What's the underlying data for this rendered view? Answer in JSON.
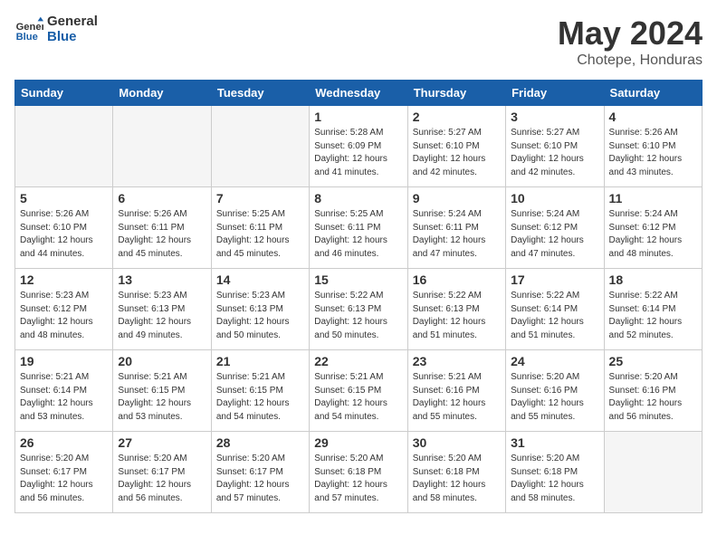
{
  "header": {
    "logo_line1": "General",
    "logo_line2": "Blue",
    "month": "May 2024",
    "location": "Chotepe, Honduras"
  },
  "weekdays": [
    "Sunday",
    "Monday",
    "Tuesday",
    "Wednesday",
    "Thursday",
    "Friday",
    "Saturday"
  ],
  "weeks": [
    [
      {
        "day": "",
        "info": ""
      },
      {
        "day": "",
        "info": ""
      },
      {
        "day": "",
        "info": ""
      },
      {
        "day": "1",
        "info": "Sunrise: 5:28 AM\nSunset: 6:09 PM\nDaylight: 12 hours\nand 41 minutes."
      },
      {
        "day": "2",
        "info": "Sunrise: 5:27 AM\nSunset: 6:10 PM\nDaylight: 12 hours\nand 42 minutes."
      },
      {
        "day": "3",
        "info": "Sunrise: 5:27 AM\nSunset: 6:10 PM\nDaylight: 12 hours\nand 42 minutes."
      },
      {
        "day": "4",
        "info": "Sunrise: 5:26 AM\nSunset: 6:10 PM\nDaylight: 12 hours\nand 43 minutes."
      }
    ],
    [
      {
        "day": "5",
        "info": "Sunrise: 5:26 AM\nSunset: 6:10 PM\nDaylight: 12 hours\nand 44 minutes."
      },
      {
        "day": "6",
        "info": "Sunrise: 5:26 AM\nSunset: 6:11 PM\nDaylight: 12 hours\nand 45 minutes."
      },
      {
        "day": "7",
        "info": "Sunrise: 5:25 AM\nSunset: 6:11 PM\nDaylight: 12 hours\nand 45 minutes."
      },
      {
        "day": "8",
        "info": "Sunrise: 5:25 AM\nSunset: 6:11 PM\nDaylight: 12 hours\nand 46 minutes."
      },
      {
        "day": "9",
        "info": "Sunrise: 5:24 AM\nSunset: 6:11 PM\nDaylight: 12 hours\nand 47 minutes."
      },
      {
        "day": "10",
        "info": "Sunrise: 5:24 AM\nSunset: 6:12 PM\nDaylight: 12 hours\nand 47 minutes."
      },
      {
        "day": "11",
        "info": "Sunrise: 5:24 AM\nSunset: 6:12 PM\nDaylight: 12 hours\nand 48 minutes."
      }
    ],
    [
      {
        "day": "12",
        "info": "Sunrise: 5:23 AM\nSunset: 6:12 PM\nDaylight: 12 hours\nand 48 minutes."
      },
      {
        "day": "13",
        "info": "Sunrise: 5:23 AM\nSunset: 6:13 PM\nDaylight: 12 hours\nand 49 minutes."
      },
      {
        "day": "14",
        "info": "Sunrise: 5:23 AM\nSunset: 6:13 PM\nDaylight: 12 hours\nand 50 minutes."
      },
      {
        "day": "15",
        "info": "Sunrise: 5:22 AM\nSunset: 6:13 PM\nDaylight: 12 hours\nand 50 minutes."
      },
      {
        "day": "16",
        "info": "Sunrise: 5:22 AM\nSunset: 6:13 PM\nDaylight: 12 hours\nand 51 minutes."
      },
      {
        "day": "17",
        "info": "Sunrise: 5:22 AM\nSunset: 6:14 PM\nDaylight: 12 hours\nand 51 minutes."
      },
      {
        "day": "18",
        "info": "Sunrise: 5:22 AM\nSunset: 6:14 PM\nDaylight: 12 hours\nand 52 minutes."
      }
    ],
    [
      {
        "day": "19",
        "info": "Sunrise: 5:21 AM\nSunset: 6:14 PM\nDaylight: 12 hours\nand 53 minutes."
      },
      {
        "day": "20",
        "info": "Sunrise: 5:21 AM\nSunset: 6:15 PM\nDaylight: 12 hours\nand 53 minutes."
      },
      {
        "day": "21",
        "info": "Sunrise: 5:21 AM\nSunset: 6:15 PM\nDaylight: 12 hours\nand 54 minutes."
      },
      {
        "day": "22",
        "info": "Sunrise: 5:21 AM\nSunset: 6:15 PM\nDaylight: 12 hours\nand 54 minutes."
      },
      {
        "day": "23",
        "info": "Sunrise: 5:21 AM\nSunset: 6:16 PM\nDaylight: 12 hours\nand 55 minutes."
      },
      {
        "day": "24",
        "info": "Sunrise: 5:20 AM\nSunset: 6:16 PM\nDaylight: 12 hours\nand 55 minutes."
      },
      {
        "day": "25",
        "info": "Sunrise: 5:20 AM\nSunset: 6:16 PM\nDaylight: 12 hours\nand 56 minutes."
      }
    ],
    [
      {
        "day": "26",
        "info": "Sunrise: 5:20 AM\nSunset: 6:17 PM\nDaylight: 12 hours\nand 56 minutes."
      },
      {
        "day": "27",
        "info": "Sunrise: 5:20 AM\nSunset: 6:17 PM\nDaylight: 12 hours\nand 56 minutes."
      },
      {
        "day": "28",
        "info": "Sunrise: 5:20 AM\nSunset: 6:17 PM\nDaylight: 12 hours\nand 57 minutes."
      },
      {
        "day": "29",
        "info": "Sunrise: 5:20 AM\nSunset: 6:18 PM\nDaylight: 12 hours\nand 57 minutes."
      },
      {
        "day": "30",
        "info": "Sunrise: 5:20 AM\nSunset: 6:18 PM\nDaylight: 12 hours\nand 58 minutes."
      },
      {
        "day": "31",
        "info": "Sunrise: 5:20 AM\nSunset: 6:18 PM\nDaylight: 12 hours\nand 58 minutes."
      },
      {
        "day": "",
        "info": ""
      }
    ]
  ]
}
